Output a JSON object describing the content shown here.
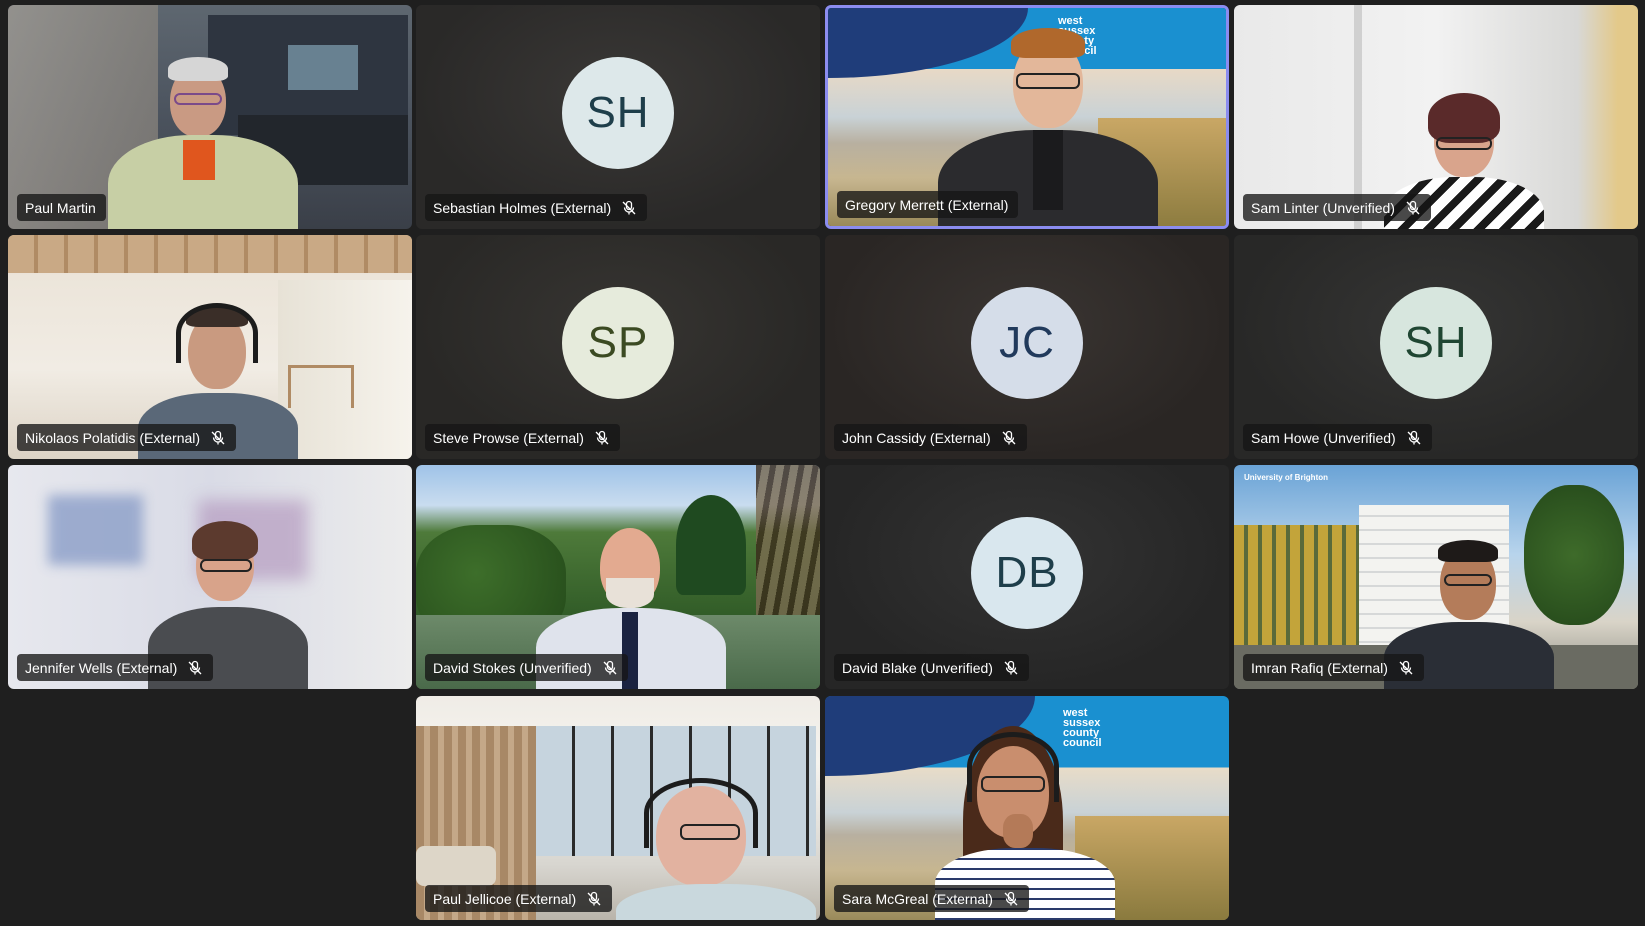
{
  "meeting": {
    "participants": [
      {
        "id": "paul-martin",
        "name": "Paul Martin",
        "muted": false,
        "video": true,
        "speaking": false
      },
      {
        "id": "sebastian-holmes",
        "name": "Sebastian Holmes (External)",
        "initials": "SH",
        "muted": true,
        "video": false,
        "avatar_color": "#dde8ea",
        "initials_color": "#1e3e4a"
      },
      {
        "id": "gregory-merrett",
        "name": "Gregory Merrett (External)",
        "muted": false,
        "video": true,
        "speaking": true,
        "background_logo": "west sussex county council"
      },
      {
        "id": "sam-linter",
        "name": "Sam Linter (Unverified)",
        "muted": true,
        "video": true
      },
      {
        "id": "nikolaos-polatidis",
        "name": "Nikolaos Polatidis (External)",
        "muted": true,
        "video": true
      },
      {
        "id": "steve-prowse",
        "name": "Steve Prowse (External)",
        "initials": "SP",
        "muted": true,
        "video": false,
        "avatar_color": "#e6ebdc",
        "initials_color": "#3b4a22"
      },
      {
        "id": "john-cassidy",
        "name": "John Cassidy (External)",
        "initials": "JC",
        "muted": true,
        "video": false,
        "avatar_color": "#d5dde9",
        "initials_color": "#213a5c"
      },
      {
        "id": "sam-howe",
        "name": "Sam Howe (Unverified)",
        "initials": "SH",
        "muted": true,
        "video": false,
        "avatar_color": "#d7e6de",
        "initials_color": "#1f4632"
      },
      {
        "id": "jennifer-wells",
        "name": "Jennifer Wells (External)",
        "muted": true,
        "video": true
      },
      {
        "id": "david-stokes",
        "name": "David Stokes (Unverified)",
        "muted": true,
        "video": true
      },
      {
        "id": "david-blake",
        "name": "David Blake (Unverified)",
        "initials": "DB",
        "muted": true,
        "video": false,
        "avatar_color": "#d9e7ee",
        "initials_color": "#1e3e4a"
      },
      {
        "id": "imran-rafiq",
        "name": "Imran Rafiq (External)",
        "muted": true,
        "video": true,
        "background_logo": "University of Brighton"
      },
      {
        "id": "paul-jellicoe",
        "name": "Paul Jellicoe (External)",
        "muted": true,
        "video": true
      },
      {
        "id": "sara-mcgreal",
        "name": "Sara McGreal (External)",
        "muted": true,
        "video": true,
        "background_logo": "west sussex county council"
      }
    ]
  },
  "colors": {
    "page_bg": "#1f1f1f",
    "speaking_border": "#8b8cf0",
    "nameplate_bg": "rgba(22,22,22,0.78)"
  },
  "icons": {
    "muted": "mic-off-icon"
  }
}
